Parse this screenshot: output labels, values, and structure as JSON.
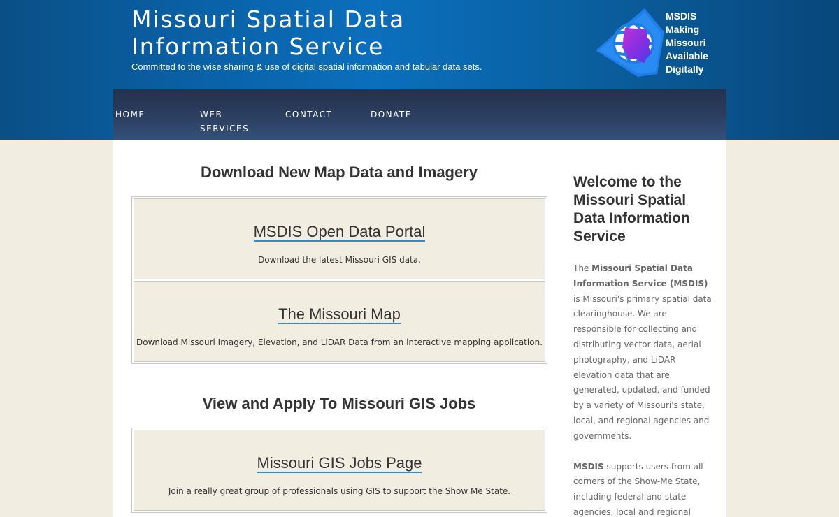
{
  "header": {
    "title_line1": "Missouri Spatial Data",
    "title_line2": "Information Service",
    "tagline": "Committed to the wise sharing & use of digital spatial information and tabular data sets."
  },
  "logo": {
    "line1": "MSDIS",
    "line2": "Making",
    "line3": "Missouri",
    "line4": "Available",
    "line5": "Digitally"
  },
  "nav": {
    "items": [
      {
        "line1": "HOME",
        "line2": ""
      },
      {
        "line1": "WEB",
        "line2": "SERVICES"
      },
      {
        "line1": "CONTACT",
        "line2": ""
      },
      {
        "line1": "DONATE",
        "line2": ""
      }
    ]
  },
  "main": {
    "section1": {
      "heading": "Download New Map Data and Imagery",
      "boxes": [
        {
          "link": "MSDIS Open Data Portal",
          "desc": "Download the latest Missouri GIS data."
        },
        {
          "link": "The Missouri Map",
          "desc": "Download Missouri Imagery, Elevation, and LiDAR Data from an interactive mapping application."
        }
      ]
    },
    "section2": {
      "heading": "View and Apply To Missouri GIS Jobs",
      "boxes": [
        {
          "link": "Missouri GIS Jobs Page",
          "desc": "Join a really great group of professionals using GIS to support the Show Me State."
        }
      ]
    }
  },
  "sidebar": {
    "title": "Welcome to the Missouri Spatial Data Information Service",
    "p1_pre": "The ",
    "p1_bold": "Missouri Spatial Data Information Service (MSDIS)",
    "p1_post": " is Missouri's primary spatial data clearinghouse. We are responsible for collecting and distributing vector data, aerial photography, and LiDAR elevation data that are generated, updated, and funded by a variety of Missouri's state, local, and regional agencies and governments.",
    "p2_bold": "MSDIS",
    "p2_post": " supports users from all corners of the Show-Me State, including federal and state agencies, local and regional"
  },
  "colors": {
    "header_blue": "#0b6fbd",
    "nav_dark": "#23324d",
    "page_bg": "#f1ede1",
    "link_underline": "#2a8fd1"
  }
}
